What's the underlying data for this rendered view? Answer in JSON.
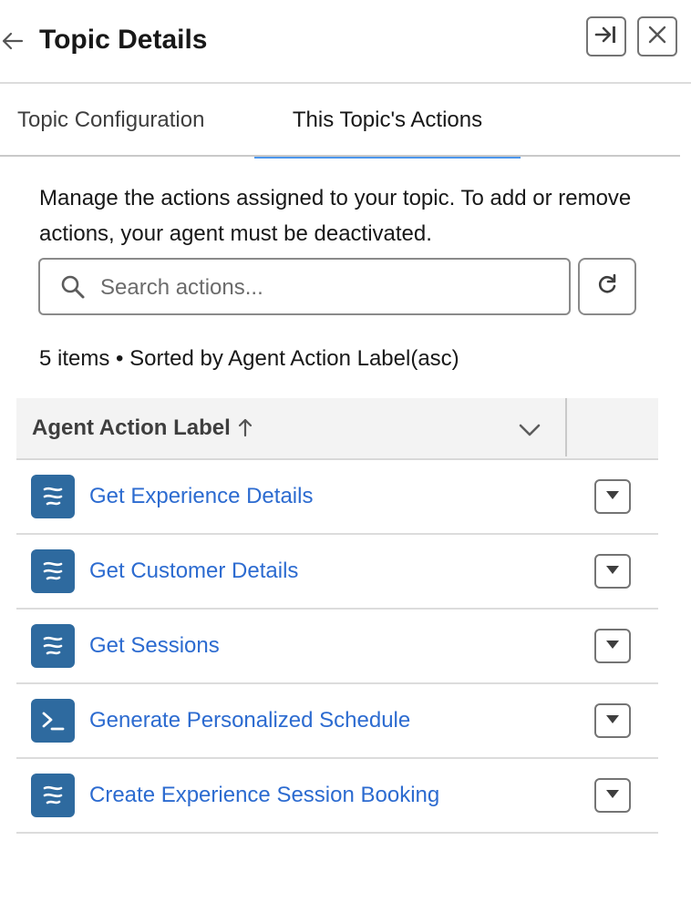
{
  "header": {
    "title": "Topic Details",
    "back_icon": "arrow-left-icon",
    "expand_icon": "collapse-to-right-icon",
    "close_icon": "close-icon"
  },
  "tabs": [
    {
      "label": "Topic Configuration",
      "active": false
    },
    {
      "label": "This Topic's Actions",
      "active": true
    }
  ],
  "description": "Manage the actions assigned to your topic. To add or remove actions, your agent must be deactivated.",
  "search": {
    "placeholder": "Search actions...",
    "value": ""
  },
  "summary": "5 items • Sorted by Agent Action Label(asc)",
  "table": {
    "column_header": "Agent Action Label",
    "sort_direction": "asc",
    "rows": [
      {
        "label": "Get Experience Details",
        "icon": "flow-icon"
      },
      {
        "label": "Get Customer Details",
        "icon": "flow-icon"
      },
      {
        "label": "Get Sessions",
        "icon": "flow-icon"
      },
      {
        "label": "Generate Personalized Schedule",
        "icon": "prompt-template-icon"
      },
      {
        "label": "Create Experience Session Booking",
        "icon": "flow-icon"
      }
    ]
  },
  "colors": {
    "accent": "#4d96ec",
    "link": "#2c6bd0",
    "icon_bg": "#2e6a9f"
  }
}
